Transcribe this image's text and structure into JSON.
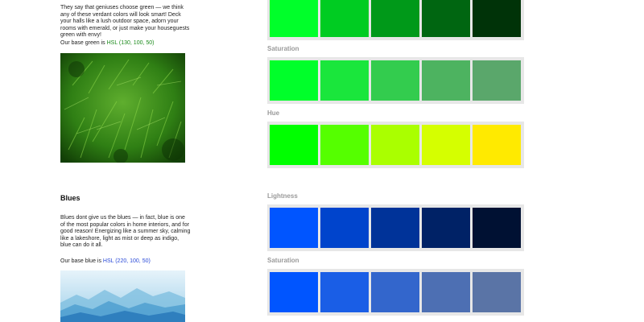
{
  "greens": {
    "intro": "They say that geniuses choose green — we think any of these verdant colors will look smart! Deck your halls like a lush outdoor space, adorn your rooms with emerald, or just make your houseguests green with envy!",
    "base_prefix": "Our base green is ",
    "base_value": "HSL (130, 100, 50)",
    "photo_icon": "foliage-photo",
    "rows": [
      {
        "label": "",
        "swatches": [
          "#00ff2a",
          "#00cc22",
          "#009919",
          "#006611",
          "#003308"
        ]
      },
      {
        "label": "Saturation",
        "swatches": [
          "#00ff2a",
          "#1ae63c",
          "#33cc4e",
          "#4db360",
          "#5aa76b"
        ]
      },
      {
        "label": "Hue",
        "swatches": [
          "#00ff00",
          "#55ff00",
          "#aaff00",
          "#d5ff00",
          "#ffea00"
        ]
      }
    ]
  },
  "blues": {
    "heading": "Blues",
    "intro": "Blues dont give us the blues — in fact, blue is one of the most popular colors in home interiors, and for good reason! Energizing like a summer sky, calming like a lakeshore, light as mist or deep as indigo, blue can do it all.",
    "base_prefix": "Our base blue is ",
    "base_value": "HSL (220, 100, 50)",
    "photo_icon": "misty-mountains-photo",
    "rows": [
      {
        "label": "Lightness",
        "swatches": [
          "#0055ff",
          "#0044cc",
          "#003399",
          "#002266",
          "#001133"
        ]
      },
      {
        "label": "Saturation",
        "swatches": [
          "#0055ff",
          "#1a5ee6",
          "#3366cc",
          "#4d6fb3",
          "#5a74a6"
        ]
      }
    ]
  },
  "colors": {
    "strip_bg": "#e7e7e7",
    "label": "#9a9a9a",
    "hsl_green": "#1a8a1a",
    "hsl_blue": "#2a4ad8"
  }
}
